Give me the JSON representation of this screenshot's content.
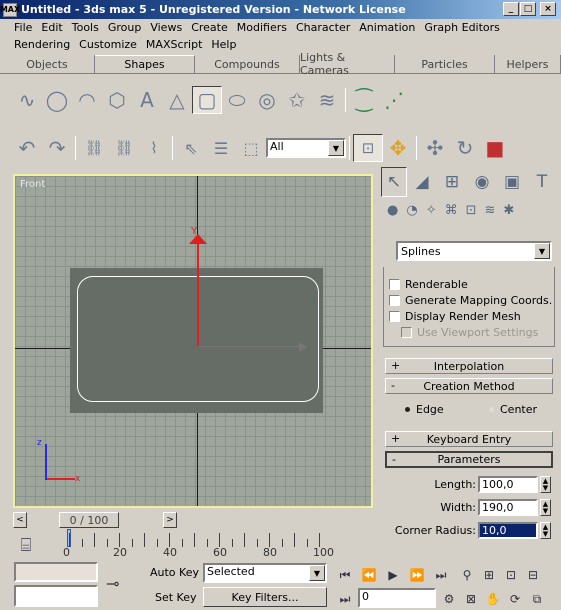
{
  "window": {
    "app_icon_label": "MAX",
    "title": "Untitled - 3ds max 5 - Unregistered Version - Network License",
    "controls": {
      "minimize": "_",
      "maximize": "□",
      "close": "×"
    }
  },
  "menu": {
    "row1": [
      "File",
      "Edit",
      "Tools",
      "Group",
      "Views",
      "Create",
      "Modifiers",
      "Character",
      "Animation",
      "Graph Editors"
    ],
    "row2": [
      "Rendering",
      "Customize",
      "MAXScript",
      "Help"
    ]
  },
  "tabs": [
    "Objects",
    "Shapes",
    "Compounds",
    "Lights & Cameras",
    "Particles",
    "Helpers"
  ],
  "active_tab": "Shapes",
  "main_toolbar": {
    "selection_filter": "All"
  },
  "viewport": {
    "label": "Front",
    "gizmo_label": "Y",
    "axis_x_label": "x",
    "axis_y_label": "z"
  },
  "command_panel": {
    "category_dropdown": "Splines",
    "rendering": {
      "renderable": "Renderable",
      "gen_mapping": "Generate Mapping Coords.",
      "display_render_mesh": "Display Render Mesh",
      "use_viewport_settings": "Use Viewport Settings"
    },
    "rollouts": {
      "interpolation": "Interpolation",
      "creation_method": "Creation Method",
      "keyboard_entry": "Keyboard Entry",
      "parameters": "Parameters"
    },
    "rollout_signs": {
      "plus": "+",
      "minus": "-"
    },
    "creation_options": {
      "edge": "Edge",
      "center": "Center"
    },
    "parameters": {
      "length_label": "Length:",
      "length_value": "100,0",
      "width_label": "Width:",
      "width_value": "190,0",
      "corner_label": "Corner Radius:",
      "corner_value": "10,0"
    }
  },
  "time": {
    "slider_text": "0 / 100",
    "ticks": [
      "0",
      "20",
      "40",
      "60",
      "80",
      "100"
    ]
  },
  "anim_controls": {
    "auto_key": "Auto Key",
    "selected": "Selected",
    "set_key": "Set Key",
    "key_filters": "Key Filters...",
    "frame_value": "0"
  }
}
